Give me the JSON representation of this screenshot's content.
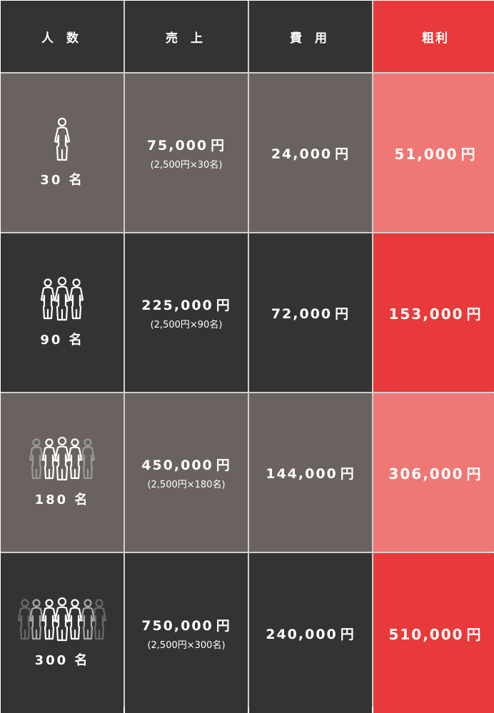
{
  "header": {
    "people": "人 数",
    "sales": "売 上",
    "cost": "費 用",
    "profit": "粗利"
  },
  "rows": [
    {
      "count": "30 名",
      "sales": "75,000",
      "sales_unit": "円",
      "detail": "(2,500円×30名)",
      "cost": "24,000",
      "cost_unit": "円",
      "profit": "51,000",
      "profit_unit": "円",
      "icon": "single-person-icon"
    },
    {
      "count": "90 名",
      "sales": "225,000",
      "sales_unit": "円",
      "detail": "(2,500円×90名)",
      "cost": "72,000",
      "cost_unit": "円",
      "profit": "153,000",
      "profit_unit": "円",
      "icon": "three-people-icon"
    },
    {
      "count": "180 名",
      "sales": "450,000",
      "sales_unit": "円",
      "detail": "(2,500円×180名)",
      "cost": "144,000",
      "cost_unit": "円",
      "profit": "306,000",
      "profit_unit": "円",
      "icon": "five-people-icon"
    },
    {
      "count": "300 名",
      "sales": "750,000",
      "sales_unit": "円",
      "detail": "(2,500円×300名)",
      "cost": "240,000",
      "cost_unit": "円",
      "profit": "510,000",
      "profit_unit": "円",
      "icon": "seven-people-icon"
    }
  ],
  "colors": {
    "dark": "#333333",
    "light": "#6a625e",
    "accent": "#e83a3a",
    "accent_light": "#ef7876"
  }
}
